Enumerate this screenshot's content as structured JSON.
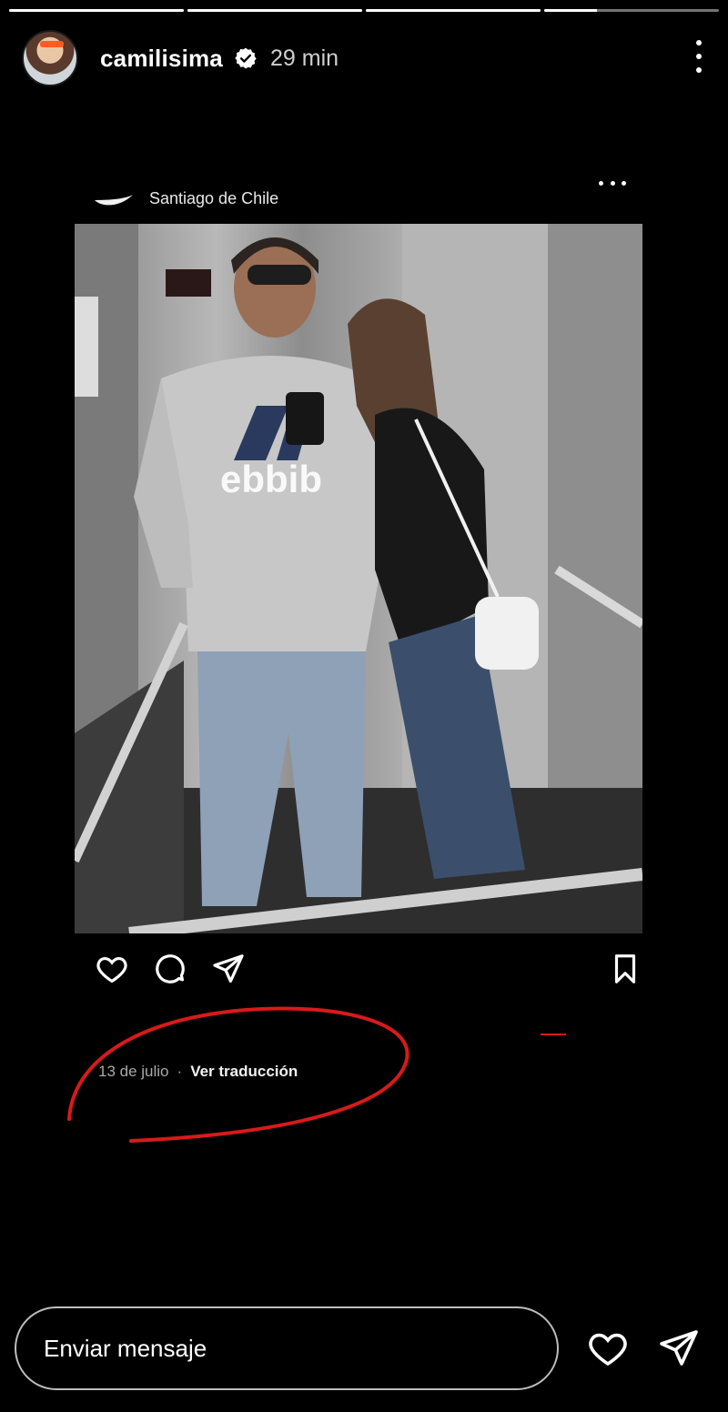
{
  "story": {
    "progress_segments": [
      1,
      1,
      1,
      0.3
    ]
  },
  "header": {
    "username": "camilisima",
    "time": "29 min"
  },
  "post": {
    "location": "Santiago de Chile",
    "date": "13 de julio",
    "separator": "·",
    "translate": "Ver traducción"
  },
  "footer": {
    "message_placeholder": "Enviar mensaje"
  },
  "colors": {
    "background": "#000000",
    "annotation": "#d81a1a",
    "verified": "#ffffff"
  },
  "icons": [
    "verified-badge-icon",
    "more-options-icon",
    "heart-icon",
    "comment-icon",
    "share-icon",
    "bookmark-icon",
    "send-icon"
  ]
}
